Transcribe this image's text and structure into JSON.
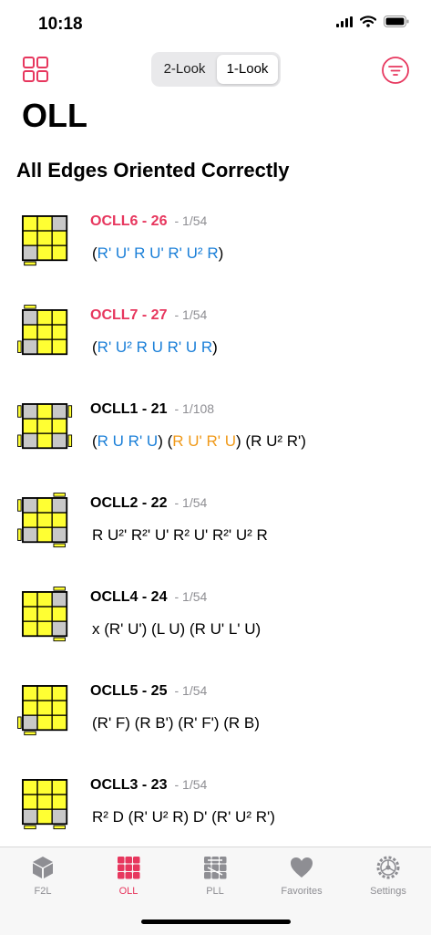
{
  "status_bar": {
    "time": "10:18"
  },
  "nav": {
    "segments": [
      "2-Look",
      "1-Look"
    ],
    "selected_segment": "1-Look"
  },
  "page_title": "OLL",
  "section_title": "All Edges Oriented Correctly",
  "cases": [
    {
      "name": "OCLL6 - 26",
      "prob": "1/54",
      "highlight": true,
      "alg": [
        {
          "t": "(",
          "c": "black"
        },
        {
          "t": "R' U' R U' R' U² R",
          "c": "blue"
        },
        {
          "t": ")",
          "c": "black"
        }
      ]
    },
    {
      "name": "OCLL7 - 27",
      "prob": "1/54",
      "highlight": true,
      "alg": [
        {
          "t": "(",
          "c": "black"
        },
        {
          "t": "R' U² R U R' U R",
          "c": "blue"
        },
        {
          "t": ")",
          "c": "black"
        }
      ]
    },
    {
      "name": "OCLL1 - 21",
      "prob": "1/108",
      "highlight": false,
      "alg": [
        {
          "t": "(",
          "c": "black"
        },
        {
          "t": "R U R' U",
          "c": "blue"
        },
        {
          "t": ") (",
          "c": "black"
        },
        {
          "t": "R U' R' U",
          "c": "orange"
        },
        {
          "t": ") (R U² R')",
          "c": "black"
        }
      ]
    },
    {
      "name": "OCLL2 - 22",
      "prob": "1/54",
      "highlight": false,
      "alg": [
        {
          "t": "R U²' R²' U' R² U' R²' U² R",
          "c": "black"
        }
      ]
    },
    {
      "name": "OCLL4 - 24",
      "prob": "1/54",
      "highlight": false,
      "alg": [
        {
          "t": "x (R' U') (L U) (R U' L' U)",
          "c": "black"
        }
      ]
    },
    {
      "name": "OCLL5 - 25",
      "prob": "1/54",
      "highlight": false,
      "alg": [
        {
          "t": "(R' F) (R B') (R' F') (R B)",
          "c": "black"
        }
      ]
    },
    {
      "name": "OCLL3 - 23",
      "prob": "1/54",
      "highlight": false,
      "alg": [
        {
          "t": "R² D (R' U² R) D' (R' U² R')",
          "c": "black"
        }
      ]
    }
  ],
  "tabs": [
    {
      "label": "F2L",
      "icon": "cube-icon",
      "active": false
    },
    {
      "label": "OLL",
      "icon": "oll-grid-icon",
      "active": true
    },
    {
      "label": "PLL",
      "icon": "pll-grid-icon",
      "active": false
    },
    {
      "label": "Favorites",
      "icon": "heart-icon",
      "active": false
    },
    {
      "label": "Settings",
      "icon": "gear-icon",
      "active": false
    }
  ],
  "colors": {
    "accent": "#e7375e",
    "alg_blue": "#1a7fd8",
    "alg_orange": "#f09a1a",
    "sticker_yellow": "#ffff33",
    "sticker_gray": "#c8c8c8"
  }
}
